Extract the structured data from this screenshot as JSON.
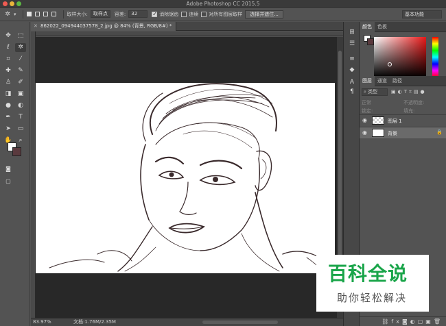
{
  "window": {
    "title": "Adobe Photoshop CC 2015.5"
  },
  "options_bar": {
    "sample_size_label": "取样大小:",
    "sample_size_value": "取样点",
    "tolerance_label": "容差:",
    "tolerance_value": "32",
    "antialias_label": "消除锯齿",
    "contiguous_label": "连续",
    "sample_all_label": "对所有图层取样",
    "select_mask_button": "选择并遮住...",
    "workspace": "基本功能"
  },
  "document": {
    "tab_title": "862022_094944037578_2.jpg @ 84% (背景, RGB/8#) *",
    "zoom": "83.97%",
    "doc_size": "文档:1.76M/2.35M"
  },
  "color_panel": {
    "tabs": [
      "颜色",
      "色板"
    ],
    "foreground": "#ffffff",
    "background": "#5a3a3e"
  },
  "layers_panel": {
    "tabs": [
      "图层",
      "通道",
      "路径"
    ],
    "kind_filter": "类型",
    "blend_mode": "正常",
    "opacity_label": "不透明度:",
    "lock_label": "锁定:",
    "fill_label": "填充:",
    "layers": [
      {
        "name": "图层 1",
        "selected": false
      },
      {
        "name": "背景",
        "selected": true,
        "locked": true
      }
    ]
  },
  "watermark": {
    "title": "百科全说",
    "subtitle": "助你轻松解决"
  },
  "tools": [
    "move-tool",
    "marquee-tool",
    "lasso-tool",
    "magic-wand-tool",
    "crop-tool",
    "eyedropper-tool",
    "healing-tool",
    "brush-tool",
    "stamp-tool",
    "history-brush-tool",
    "eraser-tool",
    "gradient-tool",
    "blur-tool",
    "dodge-tool",
    "pen-tool",
    "type-tool",
    "path-select-tool",
    "shape-tool",
    "hand-tool",
    "zoom-tool"
  ]
}
